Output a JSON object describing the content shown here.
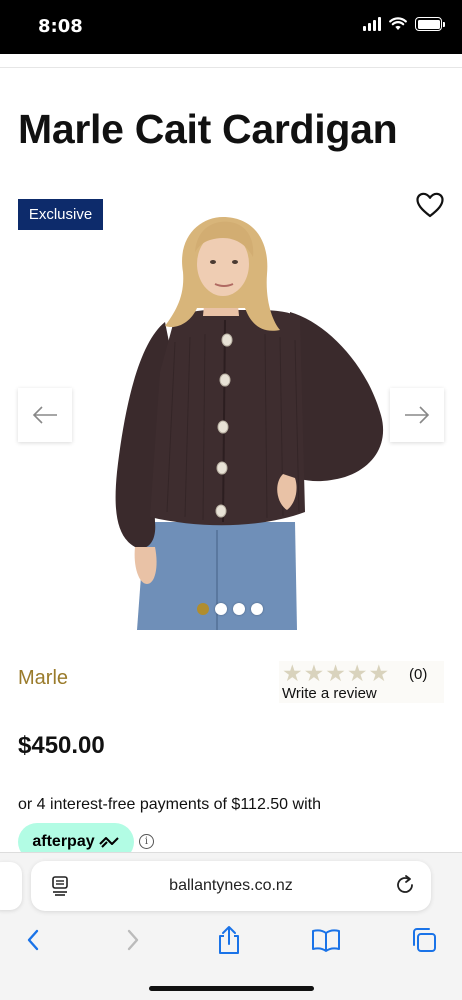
{
  "status_bar": {
    "time": "8:08"
  },
  "product": {
    "title": "Marle Cait Cardigan",
    "badge": "Exclusive",
    "brand": "Marle",
    "price": "$450.00",
    "image_count": 4,
    "active_image": 1
  },
  "reviews": {
    "stars_filled": 0,
    "stars_total": 5,
    "count": "(0)",
    "write_label": "Write a review"
  },
  "payment": {
    "installments_text": "or 4 interest-free payments of $112.50 with",
    "afterpay_label": "afterpay",
    "info_symbol": "i"
  },
  "browser": {
    "url": "ballantynes.co.nz"
  },
  "colors": {
    "badge": "#0d2b6b",
    "brand": "#9a7b2b",
    "active_dot": "#b08d2e",
    "afterpay": "#b2fce4",
    "ios_blue": "#1a73e8",
    "cardigan": "#3a2a2c",
    "jeans": "#6f8fb8"
  },
  "icons": {
    "wishlist": "heart-icon",
    "prev": "arrow-left-icon",
    "next": "arrow-right-icon",
    "back": "chevron-left-icon",
    "forward": "chevron-right-icon",
    "share": "share-icon",
    "bookmarks": "book-icon",
    "tabs": "tabs-icon"
  }
}
